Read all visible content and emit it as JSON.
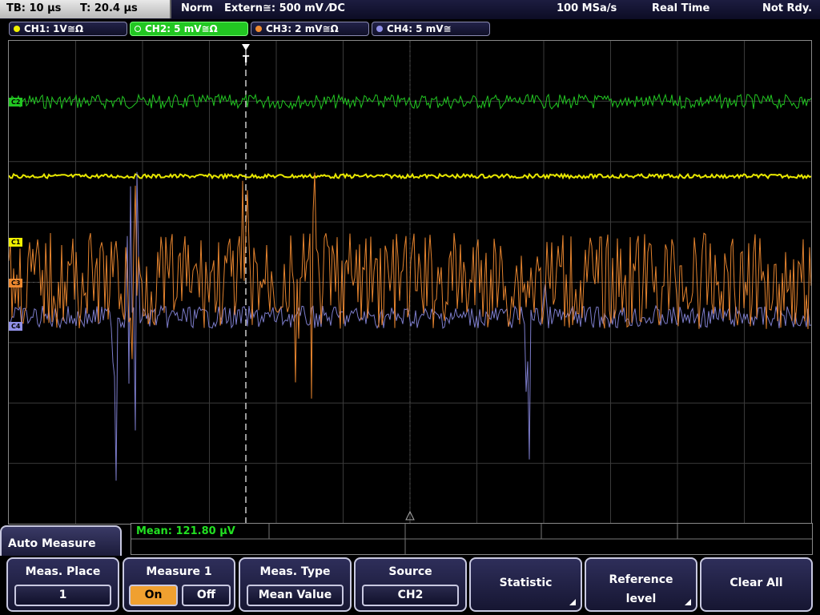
{
  "status": {
    "timebase": "TB: 10 µs",
    "trigger_time": "T: 20.4 µs",
    "mode": "Norm",
    "trigger_source": "Extern≅: 500 mV ⁄DC",
    "sample_rate": "100 MSa/s",
    "acq_mode": "Real Time",
    "state": "Not Rdy."
  },
  "channels": [
    {
      "label": "CH1: 1V≅Ω",
      "color": "#f0f000"
    },
    {
      "label": "CH2: 5 mV≅Ω",
      "color": "#22c722"
    },
    {
      "label": "CH3: 2 mV≅Ω",
      "color": "#f08a30"
    },
    {
      "label": "CH4: 5 mV≅",
      "color": "#9090e8"
    }
  ],
  "markers": {
    "c2": "C2",
    "c1": "C1",
    "c3": "C3",
    "c4": "C4",
    "trigger": "T"
  },
  "measurement": {
    "readout": "Mean: 121.80 µV"
  },
  "menu": {
    "title": "Auto Measure"
  },
  "softkeys": {
    "meas_place": {
      "label": "Meas. Place",
      "value": "1"
    },
    "measure": {
      "label": "Measure 1",
      "on": "On",
      "off": "Off"
    },
    "meas_type": {
      "label": "Meas. Type",
      "value": "Mean Value"
    },
    "source": {
      "label": "Source",
      "value": "CH2"
    },
    "statistic": {
      "label": "Statistic"
    },
    "reference": {
      "line1": "Reference",
      "line2": "level"
    },
    "clear": {
      "label": "Clear All"
    }
  }
}
